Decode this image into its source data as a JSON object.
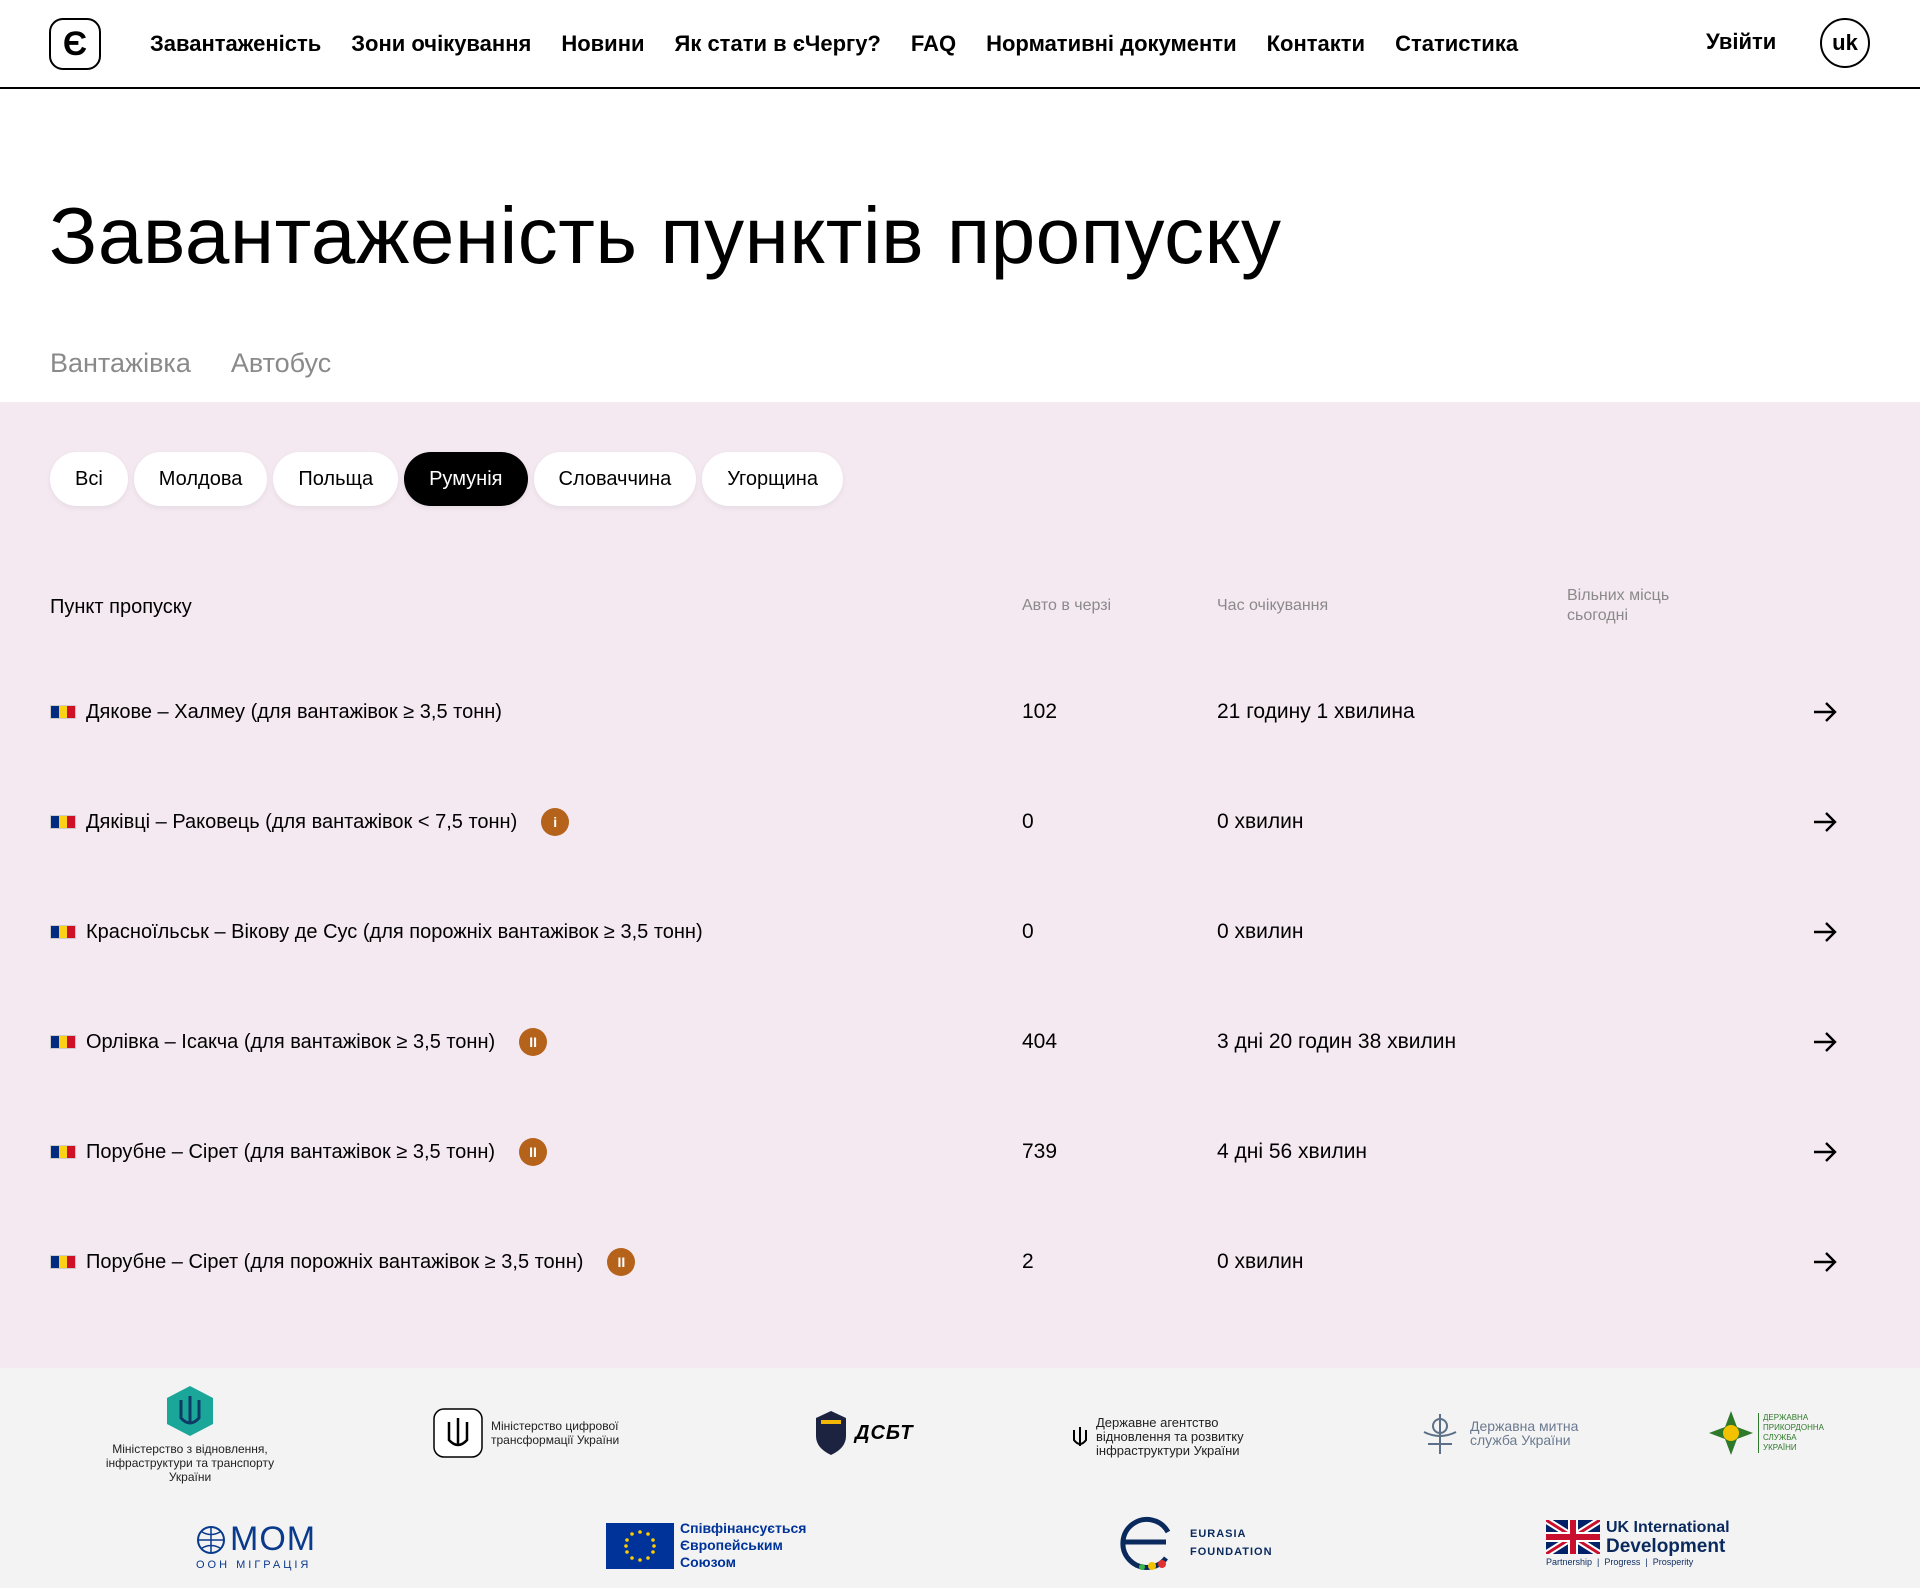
{
  "header": {
    "logo_glyph": "Є",
    "nav": [
      "Завантаженість",
      "Зони очікування",
      "Новини",
      "Як стати в єЧергу?",
      "FAQ",
      "Нормативні документи",
      "Контакти",
      "Статистика"
    ],
    "login_label": "Увійти",
    "lang_label": "uk"
  },
  "title": "Завантаженість пунктів пропуску",
  "vehicle_tabs": [
    "Вантажівка",
    "Автобус"
  ],
  "country_filters": {
    "items": [
      "Всі",
      "Молдова",
      "Польща",
      "Румунія",
      "Словаччина",
      "Угорщина"
    ],
    "active": "Румунія"
  },
  "table": {
    "headers": {
      "point": "Пункт пропуску",
      "queue": "Авто в черзі",
      "wait": "Час очікування",
      "free_line1": "Вільних місць",
      "free_line2": "сьогодні"
    },
    "rows": [
      {
        "name": "Дякове – Халмеу (для вантажівок ≥ 3,5 тонн)",
        "count": "102",
        "time": "21 годину 1 хвилина",
        "badge": ""
      },
      {
        "name": "Дяківці – Раковець (для вантажівок < 7,5 тонн)",
        "count": "0",
        "time": "0 хвилин",
        "badge": "i"
      },
      {
        "name": "Красноїльськ – Вікову де Сус (для порожніх вантажівок ≥ 3,5 тонн)",
        "count": "0",
        "time": "0 хвилин",
        "badge": ""
      },
      {
        "name": "Орлівка – Ісакча (для вантажівок ≥ 3,5 тонн)",
        "count": "404",
        "time": "3 дні 20 годин 38 хвилин",
        "badge": "II"
      },
      {
        "name": "Порубне – Сірет (для вантажівок ≥ 3,5 тонн)",
        "count": "739",
        "time": "4 дні 56 хвилин",
        "badge": "II"
      },
      {
        "name": "Порубне – Сірет (для порожніх вантажівок ≥ 3,5 тонн)",
        "count": "2",
        "time": "0 хвилин",
        "badge": "II"
      }
    ]
  },
  "partners": {
    "ministry_infra": "Міністерство з відновлення, інфраструктури та транспорту України",
    "ministry_digital": "Міністерство цифрової трансформації України",
    "dsbt": "ДСБТ",
    "agency": "Державне агентство відновлення та розвитку інфраструктури України",
    "customs": "Державна митна служба України",
    "border": "ДЕРЖАВНА ПРИКОРДОННА СЛУЖБА УКРАЇНИ",
    "mom": "МОМ",
    "mom_sub": "ООН МІГРАЦІЯ",
    "eu": "Співфінансується Європейським Союзом",
    "eurasia_line1": "EURASIA",
    "eurasia_line2": "FOUNDATION",
    "uk_line1": "UK International",
    "uk_line2": "Development",
    "uk_sub": "Partnership  |  Progress  |  Prosperity"
  },
  "colors": {
    "section_bg": "#f4e8f1",
    "badge": "#b5621a",
    "flag": [
      "#002b7f",
      "#fcd116",
      "#ce1126"
    ]
  }
}
